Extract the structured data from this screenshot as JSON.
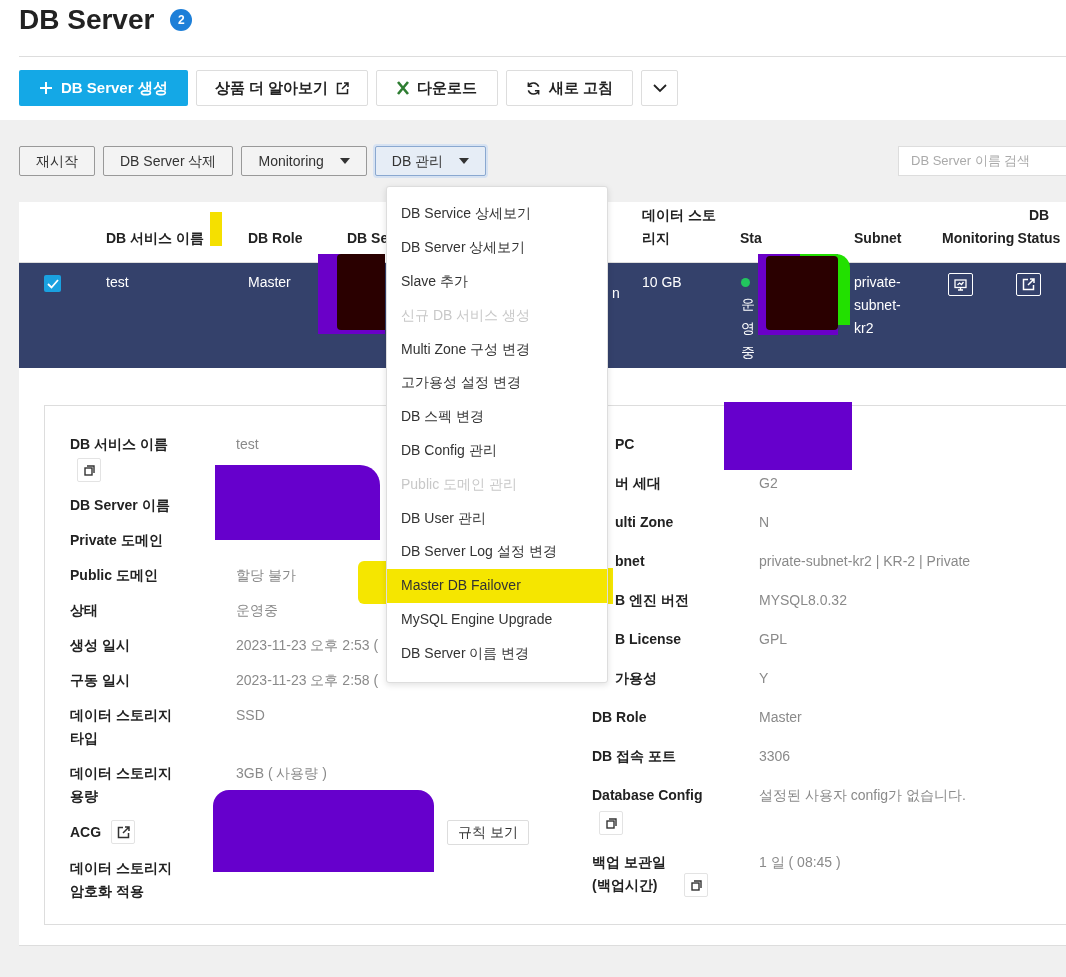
{
  "page": {
    "title": "DB Server",
    "count": "2"
  },
  "toolbar": [
    {
      "kind": "primary",
      "label": "DB Server 생성"
    },
    {
      "kind": "external",
      "label": "상품 더 알아보기"
    },
    {
      "kind": "excel",
      "label": "다운로드"
    },
    {
      "kind": "refresh",
      "label": "새로 고침"
    },
    {
      "kind": "more"
    }
  ],
  "actions": [
    {
      "label": "재시작",
      "has_caret": false,
      "expanded": false
    },
    {
      "label": "DB Server 삭제",
      "has_caret": false,
      "expanded": false
    },
    {
      "label": "Monitoring",
      "has_caret": true,
      "expanded": false
    },
    {
      "label": "DB 관리",
      "has_caret": true,
      "expanded": true
    }
  ],
  "search": {
    "placeholder": "DB Server 이름 검색"
  },
  "table": {
    "columns": [
      "DB 서비스 이름",
      "DB Role",
      "DB Se",
      "데이터 스토리지",
      "Sta",
      "Subnet",
      "Monitoring",
      "DB Status"
    ],
    "rows": [
      {
        "selected": true,
        "checked": true,
        "name": "test",
        "role": "Master",
        "column_4": "n",
        "storage": "10 GB",
        "status": "운영중",
        "subnet": "private-subnet-kr2"
      }
    ]
  },
  "menu": {
    "items": [
      {
        "label": "DB Service 상세보기",
        "disabled": false,
        "highlighted": false
      },
      {
        "label": "DB Server 상세보기",
        "disabled": false,
        "highlighted": false
      },
      {
        "label": "Slave 추가",
        "disabled": false,
        "highlighted": false
      },
      {
        "label": "신규 DB 서비스 생성",
        "disabled": true,
        "highlighted": false
      },
      {
        "label": "Multi Zone 구성 변경",
        "disabled": false,
        "highlighted": false
      },
      {
        "label": "고가용성 설정 변경",
        "disabled": false,
        "highlighted": false
      },
      {
        "label": "DB 스펙 변경",
        "disabled": false,
        "highlighted": false
      },
      {
        "label": "DB Config 관리",
        "disabled": false,
        "highlighted": false
      },
      {
        "label": "Public 도메인 관리",
        "disabled": true,
        "highlighted": false
      },
      {
        "label": "DB User 관리",
        "disabled": false,
        "highlighted": false
      },
      {
        "label": "DB Server Log 설정 변경",
        "disabled": false,
        "highlighted": false
      },
      {
        "label": "Master DB Failover",
        "disabled": false,
        "highlighted": true
      },
      {
        "label": "MySQL Engine Upgrade",
        "disabled": false,
        "highlighted": false
      },
      {
        "label": "DB Server 이름 변경",
        "disabled": false,
        "highlighted": false
      }
    ]
  },
  "details": {
    "left": [
      {
        "label": "DB 서비스 이름",
        "value": "test",
        "kind": "copyable"
      },
      {
        "label": "DB Server 이름"
      },
      {
        "label": "Private 도메인"
      },
      {
        "label": "Public 도메인",
        "value": "할당 불가"
      },
      {
        "label": "상태",
        "value": "운영중"
      },
      {
        "label": "생성 일시",
        "value": "2023-11-23 오후 2:53 ("
      },
      {
        "label": "구동 일시",
        "value": "2023-11-23 오후 2:58 ("
      },
      {
        "label": "데이터 스토리지 타입",
        "value": "SSD"
      },
      {
        "label": "데이터 스토리지 용량",
        "value": "3GB ( 사용량 )"
      },
      {
        "label": "ACG",
        "kind": "linked",
        "button": "규칙 보기"
      },
      {
        "label": "데이터 스토리지 암호화 적용"
      }
    ],
    "right": [
      {
        "label": "PC",
        "clipped": true
      },
      {
        "label": "버 세대",
        "value": "G2",
        "clipped": true
      },
      {
        "label": "ulti Zone",
        "value": "N",
        "clipped": true
      },
      {
        "label": "bnet",
        "value": "private-subnet-kr2 | KR-2 | Private",
        "clipped": true
      },
      {
        "label": "B 엔진 버전",
        "value": "MYSQL8.0.32",
        "clipped": true
      },
      {
        "label": "B License",
        "value": "GPL",
        "clipped": true
      },
      {
        "label": "가용성",
        "value": "Y",
        "clipped": true
      },
      {
        "label": "DB Role",
        "value": "Master",
        "clipped": false
      },
      {
        "label": "DB 접속 포트",
        "value": "3306",
        "clipped": false
      },
      {
        "label": "Database Config",
        "value": "설정된 사용자 config가 없습니다.",
        "kind": "copyable",
        "clipped": false
      },
      {
        "label": "백업 보관일 (백업시간)",
        "value": "1 일 ( 08:45 )",
        "kind": "copyable-inline",
        "clipped": false
      }
    ]
  }
}
